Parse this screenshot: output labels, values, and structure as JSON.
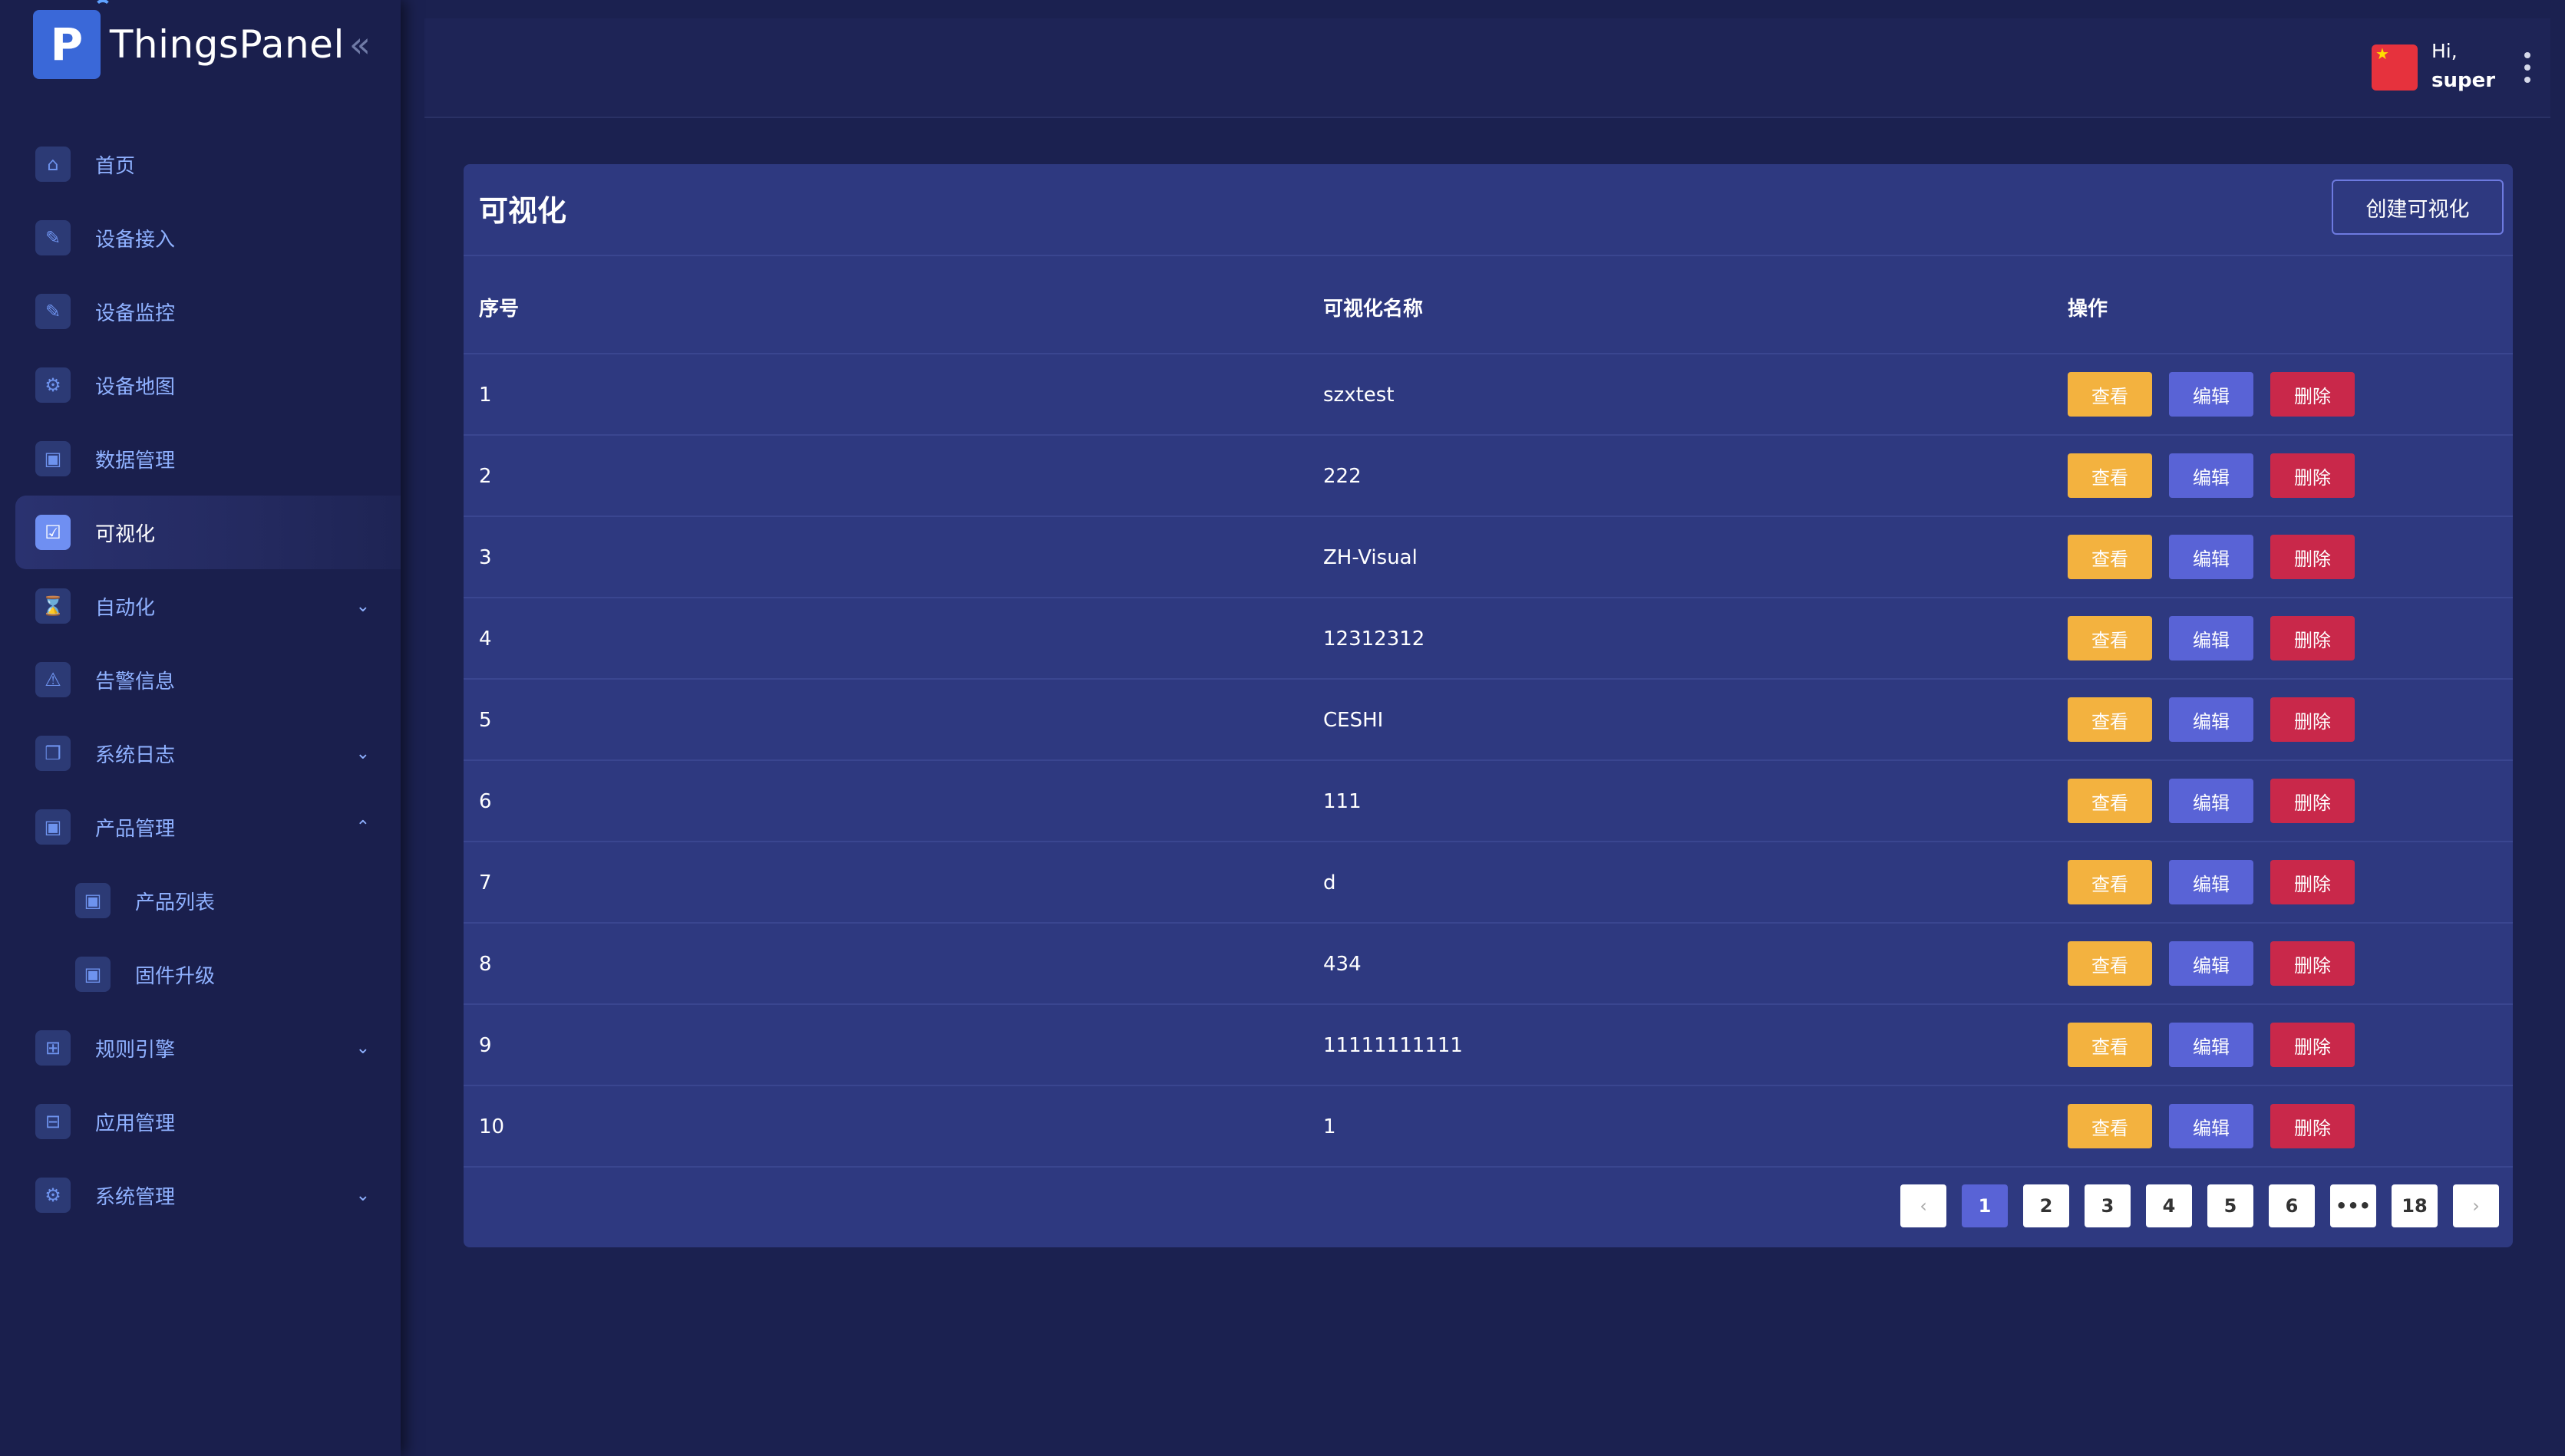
{
  "app": {
    "name": "ThingsPanel"
  },
  "sidebar": {
    "items": [
      {
        "label": "首页",
        "icon": "home-icon",
        "glyph": "⌂"
      },
      {
        "label": "设备接入",
        "icon": "device-access-icon",
        "glyph": "✎"
      },
      {
        "label": "设备监控",
        "icon": "device-monitor-icon",
        "glyph": "✎"
      },
      {
        "label": "设备地图",
        "icon": "device-map-icon",
        "glyph": "⚙"
      },
      {
        "label": "数据管理",
        "icon": "data-management-icon",
        "glyph": "▣"
      },
      {
        "label": "可视化",
        "icon": "visualization-icon",
        "glyph": "☑",
        "active": true
      },
      {
        "label": "自动化",
        "icon": "automation-icon",
        "glyph": "⌛",
        "arrow": "⌄"
      },
      {
        "label": "告警信息",
        "icon": "alarm-icon",
        "glyph": "⚠"
      },
      {
        "label": "系统日志",
        "icon": "system-log-icon",
        "glyph": "❒",
        "arrow": "⌄"
      },
      {
        "label": "产品管理",
        "icon": "product-management-icon",
        "glyph": "▣",
        "arrow": "⌃"
      },
      {
        "label": "产品列表",
        "icon": "product-list-icon",
        "glyph": "▣",
        "sub": true
      },
      {
        "label": "固件升级",
        "icon": "firmware-upgrade-icon",
        "glyph": "▣",
        "sub": true
      },
      {
        "label": "规则引擎",
        "icon": "rule-engine-icon",
        "glyph": "⊞",
        "arrow": "⌄"
      },
      {
        "label": "应用管理",
        "icon": "app-management-icon",
        "glyph": "⊟"
      },
      {
        "label": "系统管理",
        "icon": "system-management-icon",
        "glyph": "⚙",
        "arrow": "⌄"
      }
    ]
  },
  "header": {
    "greeting": "Hi,",
    "username": "super"
  },
  "page": {
    "title": "可视化",
    "create_button": "创建可视化"
  },
  "table": {
    "headers": [
      "序号",
      "可视化名称",
      "操作"
    ],
    "rows": [
      {
        "no": "1",
        "name": "szxtest"
      },
      {
        "no": "2",
        "name": "222"
      },
      {
        "no": "3",
        "name": "ZH-Visual"
      },
      {
        "no": "4",
        "name": "12312312"
      },
      {
        "no": "5",
        "name": "CESHI"
      },
      {
        "no": "6",
        "name": "111"
      },
      {
        "no": "7",
        "name": "d"
      },
      {
        "no": "8",
        "name": "434"
      },
      {
        "no": "9",
        "name": "11111111111"
      },
      {
        "no": "10",
        "name": "1"
      }
    ],
    "actions": {
      "view": "查看",
      "edit": "编辑",
      "delete": "删除"
    }
  },
  "pagination": {
    "prev": "‹",
    "next": "›",
    "pages": [
      "1",
      "2",
      "3",
      "4",
      "5",
      "6",
      "•••",
      "18"
    ],
    "current": "1"
  },
  "colors": {
    "view": "#f3b23f",
    "edit": "#5963d6",
    "delete": "#c9284a",
    "accent": "#5963d6"
  }
}
